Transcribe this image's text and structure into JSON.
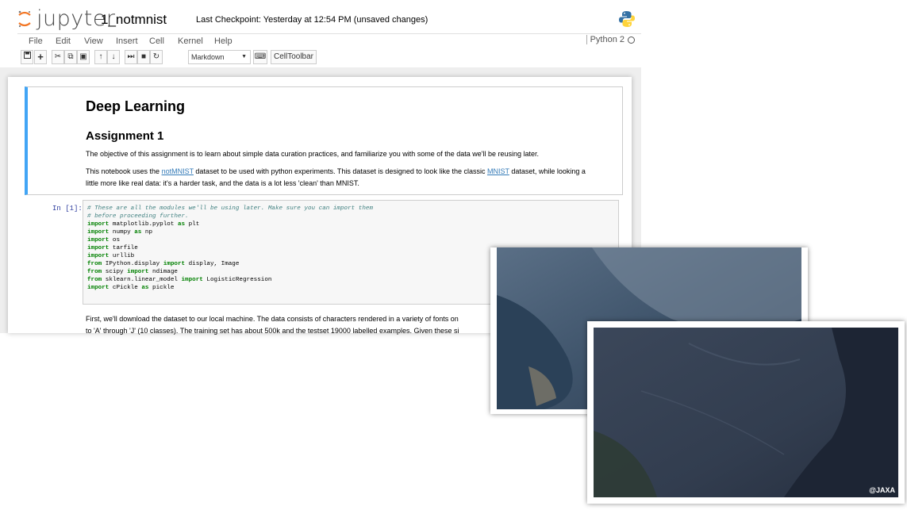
{
  "header": {
    "logo_text": "jupyter",
    "notebook_name": "1_notmnist",
    "checkpoint": "Last Checkpoint: Yesterday at 12:54 PM (unsaved changes)"
  },
  "menu": {
    "items": [
      "File",
      "Edit",
      "View",
      "Insert",
      "Cell",
      "Kernel",
      "Help"
    ],
    "kernel": "Python 2"
  },
  "toolbar": {
    "cell_type": "Markdown",
    "celltoolbar_label": "CellToolbar"
  },
  "markdown_cell": {
    "h1": "Deep Learning",
    "h2": "Assignment 1",
    "p1": "The objective of this assignment is to learn about simple data curation practices, and familiarize you with some of the data we'll be reusing later.",
    "p2_part1": "This notebook uses the ",
    "p2_link1": "notMNIST",
    "p2_part2": " dataset to be used with python experiments. This dataset is designed to look like the classic ",
    "p2_link2": "MNIST",
    "p2_part3": " dataset, while looking a",
    "p2_line2": "little more like real data: it's a harder task, and the data is a lot less 'clean' than MNIST."
  },
  "code_cell": {
    "prompt": "In [1]:",
    "comment1": "# These are all the modules we'll be using later. Make sure you can import them",
    "comment2": "# before proceeding further.",
    "lines": [
      {
        "kw": "import",
        "rest": " matplotlib.pyplot ",
        "kw2": "as",
        "rest2": " plt"
      },
      {
        "kw": "import",
        "rest": " numpy ",
        "kw2": "as",
        "rest2": " np"
      },
      {
        "kw": "import",
        "rest": " os",
        "kw2": "",
        "rest2": ""
      },
      {
        "kw": "import",
        "rest": " tarfile",
        "kw2": "",
        "rest2": ""
      },
      {
        "kw": "import",
        "rest": " urllib",
        "kw2": "",
        "rest2": ""
      },
      {
        "kw": "from",
        "rest": " IPython.display ",
        "kw2": "import",
        "rest2": " display, Image"
      },
      {
        "kw": "from",
        "rest": " scipy ",
        "kw2": "import",
        "rest2": " ndimage"
      },
      {
        "kw": "from",
        "rest": " sklearn.linear_model ",
        "kw2": "import",
        "rest2": " LogisticRegression"
      },
      {
        "kw": "import",
        "rest": " cPickle ",
        "kw2": "as",
        "rest2": " pickle"
      }
    ]
  },
  "markdown_cell2": {
    "line1": "First, we'll download the dataset to our local machine. The data consists of characters rendered in a variety of fonts on",
    "line2": "to 'A' through 'J' (10 classes). The training set has about 500k and the testset 19000 labelled examples. Given these si"
  },
  "photos": {
    "watermark": "@JAXA"
  },
  "colors": {
    "selected_cell_border": "#42a5f5",
    "link": "#337ab7",
    "keyword": "#008000",
    "comment": "#408080"
  }
}
